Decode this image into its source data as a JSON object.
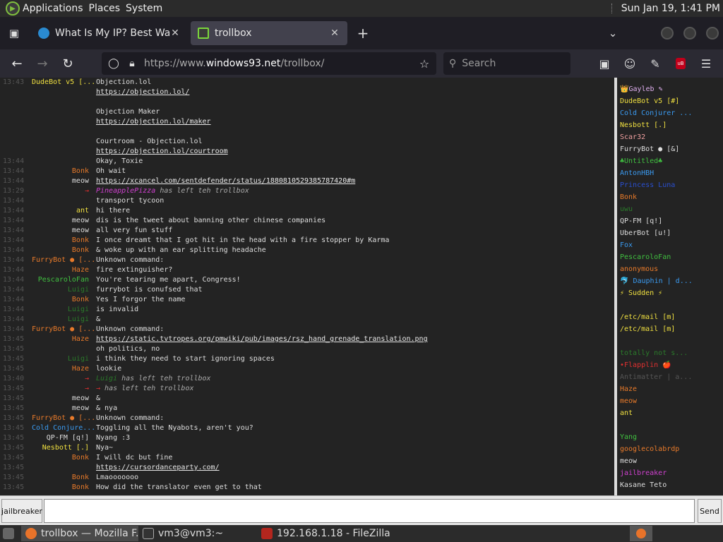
{
  "panel": {
    "menus": [
      "Applications",
      "Places",
      "System"
    ],
    "clock": "Sun Jan 19,  1:41 PM"
  },
  "tabs": [
    {
      "title": "What Is My IP? Best Way To",
      "active": false
    },
    {
      "title": "trollbox",
      "active": true
    }
  ],
  "nav": {
    "url_prefix": "https://www.",
    "url_domain": "windows93.net",
    "url_path": "/trollbox/",
    "search_placeholder": "Search"
  },
  "messages": [
    {
      "time": "13:43",
      "nick": "DudeBot v5 [...",
      "nick_color": "#f0e040",
      "nick_align": "left",
      "text": "Objection.lol"
    },
    {
      "time": "",
      "nick": "",
      "nick_color": "",
      "text": "https://objection.lol/",
      "link": true
    },
    {
      "time": "",
      "nick": "",
      "nick_color": "",
      "text": ""
    },
    {
      "time": "",
      "nick": "",
      "nick_color": "",
      "text": "Objection Maker"
    },
    {
      "time": "",
      "nick": "",
      "nick_color": "",
      "text": "https://objection.lol/maker",
      "link": true
    },
    {
      "time": "",
      "nick": "",
      "nick_color": "",
      "text": ""
    },
    {
      "time": "",
      "nick": "",
      "nick_color": "",
      "text": "Courtroom - Objection.lol"
    },
    {
      "time": "",
      "nick": "",
      "nick_color": "",
      "text": "https://objection.lol/courtroom",
      "link": true
    },
    {
      "time": "13:44",
      "nick": "",
      "nick_color": "#2a4fd0",
      "text": "Okay, Toxie"
    },
    {
      "time": "13:44",
      "nick": "Bonk",
      "nick_color": "#e87a2a",
      "text": "Oh wait"
    },
    {
      "time": "13:44",
      "nick": "meow",
      "nick_color": "#dddddd",
      "text": "https://xcancel.com/sentdefender/status/1880810529385787420#m",
      "link": true
    },
    {
      "time": "13:29",
      "nick": "→",
      "nick_color": "#e03030",
      "text": "PineapplePizza has left teh trollbox",
      "sys": true,
      "sys_nick_color": "#d040d0"
    },
    {
      "time": "13:44",
      "nick": "",
      "nick_color": "#2a4fd0",
      "text": "transport tycoon"
    },
    {
      "time": "13:44",
      "nick": "ant",
      "nick_color": "#f0e040",
      "text": "hi there"
    },
    {
      "time": "13:44",
      "nick": "meow",
      "nick_color": "#dddddd",
      "text": "dis is the tweet about banning other chinese companies"
    },
    {
      "time": "13:44",
      "nick": "meow",
      "nick_color": "#dddddd",
      "text": "all very fun stuff"
    },
    {
      "time": "13:44",
      "nick": "Bonk",
      "nick_color": "#e87a2a",
      "text": "I once dreamt that I got hit in the head with a fire stopper by Karma"
    },
    {
      "time": "13:44",
      "nick": "Bonk",
      "nick_color": "#e87a2a",
      "text": "& woke up with an ear splitting headache"
    },
    {
      "time": "13:44",
      "nick": "FurryBot ● [...",
      "nick_color": "#e87a2a",
      "nick_align": "left",
      "text": "Unknown command:"
    },
    {
      "time": "13:44",
      "nick": "Haze",
      "nick_color": "#e87a2a",
      "text": "fire extinguisher?"
    },
    {
      "time": "13:44",
      "nick": "PescaroloFan",
      "nick_color": "#40c040",
      "text": "You're tearing me apart, Congress!"
    },
    {
      "time": "13:44",
      "nick": "Luigi",
      "nick_color": "#2a7a2a",
      "text": "furrybot is conufsed that"
    },
    {
      "time": "13:44",
      "nick": "Bonk",
      "nick_color": "#e87a2a",
      "text": "Yes I forgor the name"
    },
    {
      "time": "13:44",
      "nick": "Luigi",
      "nick_color": "#2a7a2a",
      "text": "is invalid"
    },
    {
      "time": "13:44",
      "nick": "Luigi",
      "nick_color": "#2a7a2a",
      "text": "&"
    },
    {
      "time": "13:44",
      "nick": "FurryBot ● [...",
      "nick_color": "#e87a2a",
      "nick_align": "left",
      "text": "Unknown command:"
    },
    {
      "time": "13:45",
      "nick": "Haze",
      "nick_color": "#e87a2a",
      "text": "https://static.tvtropes.org/pmwiki/pub/images/rsz_hand_grenade_translation.png",
      "link": true
    },
    {
      "time": "13:45",
      "nick": "",
      "nick_color": "#2a4fd0",
      "text": "oh politics, no"
    },
    {
      "time": "13:45",
      "nick": "Luigi",
      "nick_color": "#2a7a2a",
      "text": "i think they need to start ignoring spaces"
    },
    {
      "time": "13:45",
      "nick": "Haze",
      "nick_color": "#e87a2a",
      "text": "lookie"
    },
    {
      "time": "13:40",
      "nick": "→",
      "nick_color": "#e03030",
      "text": "Luigi has left teh trollbox",
      "sys": true,
      "sys_nick_color": "#2a7a2a"
    },
    {
      "time": "13:45",
      "nick": "→",
      "nick_color": "#e03030",
      "text": "→ has left teh trollbox",
      "sys": true,
      "sys_nick_color": "#e03030"
    },
    {
      "time": "13:45",
      "nick": "meow",
      "nick_color": "#dddddd",
      "text": "&"
    },
    {
      "time": "13:45",
      "nick": "meow",
      "nick_color": "#dddddd",
      "text": "& nya"
    },
    {
      "time": "13:45",
      "nick": "FurryBot ● [...",
      "nick_color": "#e87a2a",
      "nick_align": "left",
      "text": "Unknown command:"
    },
    {
      "time": "13:45",
      "nick": "Cold Conjure...",
      "nick_color": "#3a9af0",
      "nick_align": "left",
      "text": "Toggling all the Nyabots, aren't you?"
    },
    {
      "time": "13:45",
      "nick": "QP-FM [q!]",
      "nick_color": "#dddddd",
      "text": "Nyang :3"
    },
    {
      "time": "13:45",
      "nick": "Nesbott [.]",
      "nick_color": "#f0e040",
      "text": "Nya~"
    },
    {
      "time": "13:45",
      "nick": "Bonk",
      "nick_color": "#e87a2a",
      "text": "I will dc but fine"
    },
    {
      "time": "13:45",
      "nick": "",
      "nick_color": "#2a4fd0",
      "text": "https://cursordanceparty.com/",
      "link": true
    },
    {
      "time": "13:45",
      "nick": "Bonk",
      "nick_color": "#e87a2a",
      "text": "Lmaooooooo"
    },
    {
      "time": "13:45",
      "nick": "Bonk",
      "nick_color": "#e87a2a",
      "text": "How did the translator even get to that"
    }
  ],
  "users": [
    {
      "name": "👑Gayleb ✎",
      "color": "#e0b0f0"
    },
    {
      "name": "DudeBot v5 [#]",
      "color": "#f0e040"
    },
    {
      "name": "Cold Conjurer ...",
      "color": "#3a9af0"
    },
    {
      "name": "Nesbott [.]",
      "color": "#f0e040"
    },
    {
      "name": "Scar32",
      "color": "#f0a0a0"
    },
    {
      "name": "FurryBot ● [&]",
      "color": "#dddddd"
    },
    {
      "name": "♣Untitled♣",
      "color": "#40c040"
    },
    {
      "name": "AntonHBH",
      "color": "#3a9af0"
    },
    {
      "name": "Princess Luna",
      "color": "#2a4fd0"
    },
    {
      "name": "Bonk",
      "color": "#e87a2a"
    },
    {
      "name": "uwu",
      "color": "#2a7a2a"
    },
    {
      "name": "QP-FM [q!]",
      "color": "#dddddd"
    },
    {
      "name": "UberBot [u!]",
      "color": "#dddddd"
    },
    {
      "name": "Fox",
      "color": "#3a9af0"
    },
    {
      "name": "PescaroloFan",
      "color": "#40c040"
    },
    {
      "name": "anonymous",
      "color": "#e87a2a"
    },
    {
      "name": "🐬 Dauphin | d...",
      "color": "#3a9af0"
    },
    {
      "name": "⚡ Sudden ⚡",
      "color": "#f0e040"
    },
    {
      "name": "",
      "color": "#2a4fd0"
    },
    {
      "name": "/etc/mail [m]",
      "color": "#f0e040"
    },
    {
      "name": "/etc/mail [m]",
      "color": "#f0e040"
    },
    {
      "name": "",
      "color": "#2a4fd0"
    },
    {
      "name": "totally not s...",
      "color": "#2a7a2a"
    },
    {
      "name": "•Flapplin 🍎",
      "color": "#e03030"
    },
    {
      "name": "Antimatter | a...",
      "color": "#555555"
    },
    {
      "name": "Haze",
      "color": "#e87a2a"
    },
    {
      "name": "meow",
      "color": "#e87a2a"
    },
    {
      "name": "ant",
      "color": "#f0e040"
    },
    {
      "name": "",
      "color": "#2a4fd0"
    },
    {
      "name": "Yang",
      "color": "#40c040"
    },
    {
      "name": "googlecolabrdp",
      "color": "#e87a2a"
    },
    {
      "name": "meow",
      "color": "#dddddd"
    },
    {
      "name": "jailbreaker",
      "color": "#d040d0"
    },
    {
      "name": "Kasane Teto",
      "color": "#dddddd"
    }
  ],
  "input": {
    "nick": "jailbreaker",
    "value": "",
    "send": "Send"
  },
  "taskbar": [
    {
      "label": "trollbox — Mozilla F...",
      "active": true,
      "icon": "firefox-icon"
    },
    {
      "label": "vm3@vm3:~",
      "active": false,
      "icon": "terminal-icon"
    },
    {
      "label": "192.168.1.18 - FileZilla",
      "active": false,
      "icon": "filezilla-icon"
    }
  ]
}
